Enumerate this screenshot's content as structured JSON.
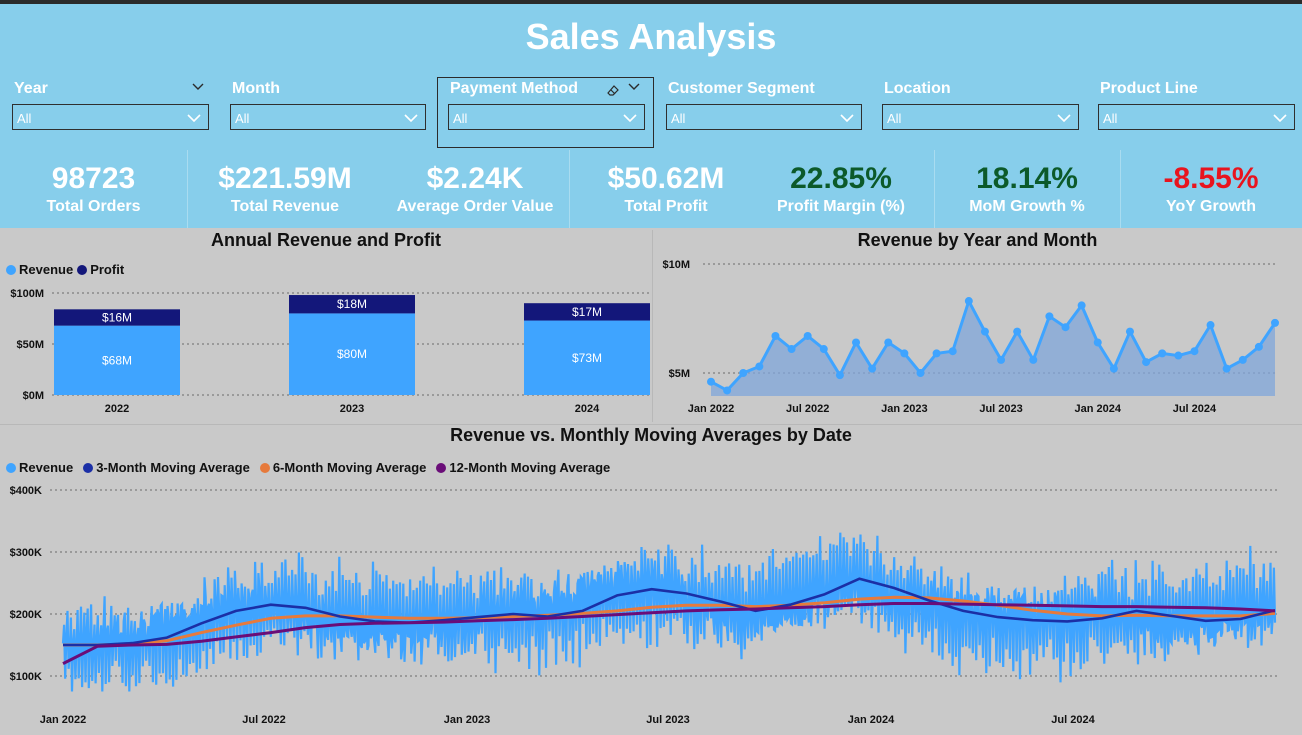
{
  "title": "Sales Analysis",
  "colors": {
    "header_bg": "#87ceeb",
    "panel_bg": "#c9c9c9",
    "revenue": "#3fa4ff",
    "profit": "#13177a",
    "ma3": "#1b2fa6",
    "ma6": "#e67a3c",
    "ma12": "#6a0d78",
    "positive": "#0c5a2a",
    "negative": "#e8141e"
  },
  "slicers": [
    {
      "label": "Year",
      "value": "All"
    },
    {
      "label": "Month",
      "value": "All"
    },
    {
      "label": "Payment Method",
      "value": "All"
    },
    {
      "label": "Customer Segment",
      "value": "All"
    },
    {
      "label": "Location",
      "value": "All"
    },
    {
      "label": "Product Line",
      "value": "All"
    }
  ],
  "kpis": [
    {
      "value": "98723",
      "label": "Total Orders"
    },
    {
      "value": "$221.59M",
      "label": "Total Revenue"
    },
    {
      "value": "$2.24K",
      "label": "Average Order Value"
    },
    {
      "value": "$50.62M",
      "label": "Total Profit"
    },
    {
      "value": "22.85%",
      "label": "Profit Margin (%)"
    },
    {
      "value": "18.14%",
      "label": "MoM Growth %"
    },
    {
      "value": "-8.55%",
      "label": "YoY Growth"
    }
  ],
  "chart_data": [
    {
      "type": "bar",
      "title": "Annual Revenue and Profit",
      "legend": [
        "Revenue",
        "Profit"
      ],
      "categories": [
        "2022",
        "2023",
        "2024"
      ],
      "series": [
        {
          "name": "Revenue",
          "values": [
            68,
            80,
            73
          ],
          "labels": [
            "$68M",
            "$80M",
            "$73M"
          ]
        },
        {
          "name": "Profit",
          "values": [
            16,
            18,
            17
          ],
          "labels": [
            "$16M",
            "$18M",
            "$17M"
          ]
        }
      ],
      "yticks": [
        "$0M",
        "$50M",
        "$100M"
      ],
      "ylim": [
        0,
        100
      ],
      "stacked": true,
      "legend_position": "top-left"
    },
    {
      "type": "area",
      "title": "Revenue by Year and Month",
      "x_ticks": [
        "Jan 2022",
        "Jul 2022",
        "Jan 2023",
        "Jul 2023",
        "Jan 2024",
        "Jul 2024"
      ],
      "yticks": [
        "$5M",
        "$10M"
      ],
      "ylim": [
        4,
        10
      ],
      "values": [
        4.6,
        4.2,
        5.0,
        5.3,
        6.7,
        6.1,
        6.7,
        6.1,
        4.9,
        6.4,
        5.2,
        6.4,
        5.9,
        5.0,
        5.9,
        6.0,
        8.3,
        6.9,
        5.6,
        6.9,
        5.6,
        7.6,
        7.1,
        8.1,
        6.4,
        5.2,
        6.9,
        5.5,
        5.9,
        5.8,
        6.0,
        7.2,
        5.2,
        5.6,
        6.2,
        7.3
      ]
    },
    {
      "type": "line",
      "title": "Revenue vs. Monthly Moving Averages by Date",
      "legend": [
        "Revenue",
        "3-Month Moving Average",
        "6-Month Moving Average",
        "12-Month Moving Average"
      ],
      "x_ticks": [
        "Jan 2022",
        "Jul 2022",
        "Jan 2023",
        "Jul 2023",
        "Jan 2024",
        "Jul 2024"
      ],
      "yticks": [
        "$100K",
        "$200K",
        "$300K",
        "$400K"
      ],
      "ylim": [
        70,
        400
      ],
      "ma3_monthly": [
        150,
        150,
        153,
        162,
        185,
        205,
        215,
        210,
        196,
        188,
        186,
        190,
        195,
        200,
        196,
        205,
        230,
        240,
        233,
        220,
        205,
        215,
        232,
        257,
        242,
        222,
        205,
        195,
        190,
        188,
        193,
        205,
        197,
        189,
        192,
        206
      ],
      "ma6_monthly": [
        150,
        150,
        152,
        157,
        170,
        182,
        193,
        197,
        197,
        195,
        193,
        193,
        194,
        196,
        198,
        201,
        205,
        211,
        214,
        214,
        212,
        214,
        218,
        224,
        227,
        226,
        221,
        214,
        206,
        200,
        197,
        198,
        197,
        197,
        197,
        201
      ],
      "ma12_monthly": [
        120,
        148,
        150,
        151,
        156,
        163,
        170,
        178,
        183,
        185,
        186,
        187,
        189,
        191,
        193,
        196,
        199,
        202,
        205,
        207,
        208,
        210,
        212,
        215,
        217,
        217,
        216,
        215,
        214,
        213,
        212,
        212,
        211,
        210,
        208,
        205
      ]
    }
  ]
}
